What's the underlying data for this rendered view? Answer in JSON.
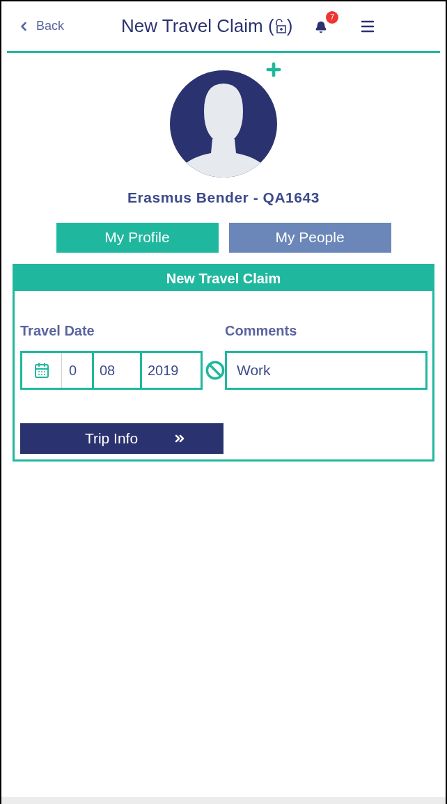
{
  "header": {
    "back": "Back",
    "title": "New Travel Claim",
    "title_open": "(",
    "title_close": ")",
    "notification_count": "7"
  },
  "profile": {
    "name": "Erasmus Bender - QA1643"
  },
  "tabs": [
    {
      "label": "My Profile",
      "selected": true
    },
    {
      "label": "My People",
      "selected": false
    }
  ],
  "card": {
    "title": "New Travel Claim",
    "travel_date": {
      "label": "Travel Date",
      "day": "0",
      "month": "08",
      "year": "2019"
    },
    "comments": {
      "label": "Comments",
      "value": "Work"
    },
    "button": "Trip Info"
  }
}
